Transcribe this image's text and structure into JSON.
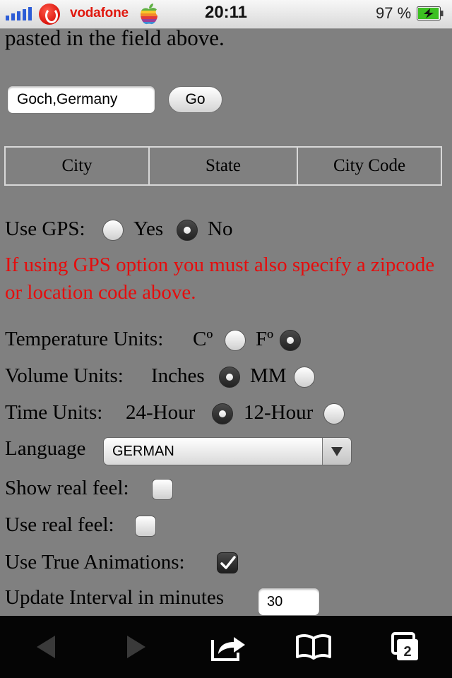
{
  "status_bar": {
    "carrier": "vodafone",
    "time": "20:11",
    "battery": "97 %",
    "battery_level": 0.97
  },
  "content": {
    "intro_tail": "pasted in the field above.",
    "location_input_value": "Goch,Germany",
    "go_button": "Go",
    "table_headers": [
      "City",
      "State",
      "City Code"
    ],
    "gps": {
      "label": "Use GPS:",
      "yes": "Yes",
      "no": "No",
      "selected": "No"
    },
    "warning": "If using GPS option you must also specify a zipcode or location code above.",
    "temperature": {
      "label": "Temperature Units:",
      "celsius": "Cº",
      "fahrenheit": "Fº",
      "selected": "Fº"
    },
    "volume": {
      "label": "Volume Units:",
      "inches": "Inches",
      "mm": "MM",
      "selected": "Inches"
    },
    "time": {
      "label": "Time Units:",
      "h24": "24-Hour",
      "h12": "12-Hour",
      "selected": "24-Hour"
    },
    "language": {
      "label": "Language",
      "value": "GERMAN"
    },
    "show_real_feel": {
      "label": "Show real feel:",
      "checked": false
    },
    "use_real_feel": {
      "label": "Use real feel:",
      "checked": false
    },
    "true_animations": {
      "label": "Use True Animations:",
      "checked": true
    },
    "update_interval": {
      "label": "Update Interval in minutes",
      "value": "30"
    }
  },
  "toolbar": {
    "tabs_count": "2",
    "icons": [
      "back-arrow-icon",
      "forward-arrow-icon",
      "share-icon",
      "bookmarks-icon",
      "tabs-icon"
    ]
  },
  "colors": {
    "page_background": "#808080",
    "warning_text": "#e50d0d",
    "toolbar": "#050505"
  }
}
